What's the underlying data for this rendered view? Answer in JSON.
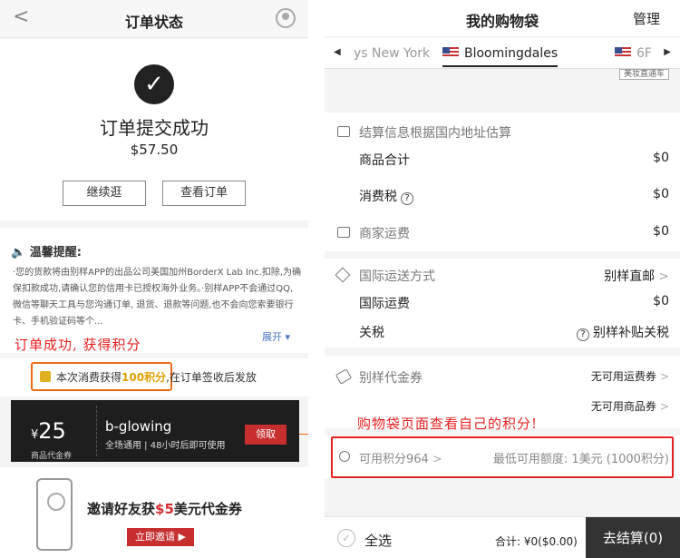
{
  "left": {
    "header": {
      "title": "订单状态"
    },
    "success": {
      "title": "订单提交成功",
      "amount": "$57.50",
      "continue_label": "继续逛",
      "view_order_label": "查看订单"
    },
    "tips": {
      "heading": "温馨提醒:",
      "text": "·您的货款将由别样APP的出品公司美国加州BorderX Lab Inc.扣除,为确保扣款成功,请确认您的信用卡已授权海外业务。·别样APP不会通过QQ,微信等聊天工具与您沟通订单, 退货、退款等问题,也不会向您索要银行卡、手机验证码等个...",
      "expand_label": "展开 ▾"
    },
    "annotation": "订单成功, 获得积分",
    "points": {
      "prefix": "本次消费获得",
      "value": "100积分",
      "suffix": ",在订单签收后发放"
    },
    "coupon": {
      "amount": "25",
      "currency": "¥",
      "type": "商品代金券",
      "name": "b-glowing",
      "desc": "全场通用 | 48小时后即可使用",
      "claim_label": "领取"
    },
    "invite": {
      "text_prefix": "邀请好友获",
      "text_amount": "$5",
      "text_suffix": "美元代金券",
      "button_label": "立即邀请 ▶"
    }
  },
  "right": {
    "header": {
      "title": "我的购物袋",
      "manage_label": "管理"
    },
    "tabs": [
      {
        "label": "ys New York",
        "active": false
      },
      {
        "label": "Bloomingdales",
        "active": true
      },
      {
        "label": "6F",
        "active": false
      }
    ],
    "express_tag": "美妆直通车",
    "settlement": {
      "heading": "结算信息根据国内地址估算",
      "subtotal_label": "商品合计",
      "subtotal_value": "$0",
      "tax_label": "消费税",
      "tax_value": "$0",
      "shipping_label": "商家运费",
      "shipping_value": "$0"
    },
    "intl": {
      "method_label": "国际运送方式",
      "method_value": "别样直邮",
      "fee_label": "国际运费",
      "fee_value": "$0",
      "duty_label": "关税",
      "duty_value": "别样补贴关税"
    },
    "vouchers": {
      "label": "别样代金券",
      "shipping_voucher": "无可用运费券",
      "product_voucher": "无可用商品券"
    },
    "annotation": "购物袋页面查看自己的积分!",
    "points": {
      "label": "可用积分964",
      "min_label": "最低可用额度: 1美元 (1000积分)"
    },
    "bottom": {
      "select_all": "全选",
      "total": "合计: ¥0($0.00)",
      "checkout": "去结算(0)"
    }
  }
}
